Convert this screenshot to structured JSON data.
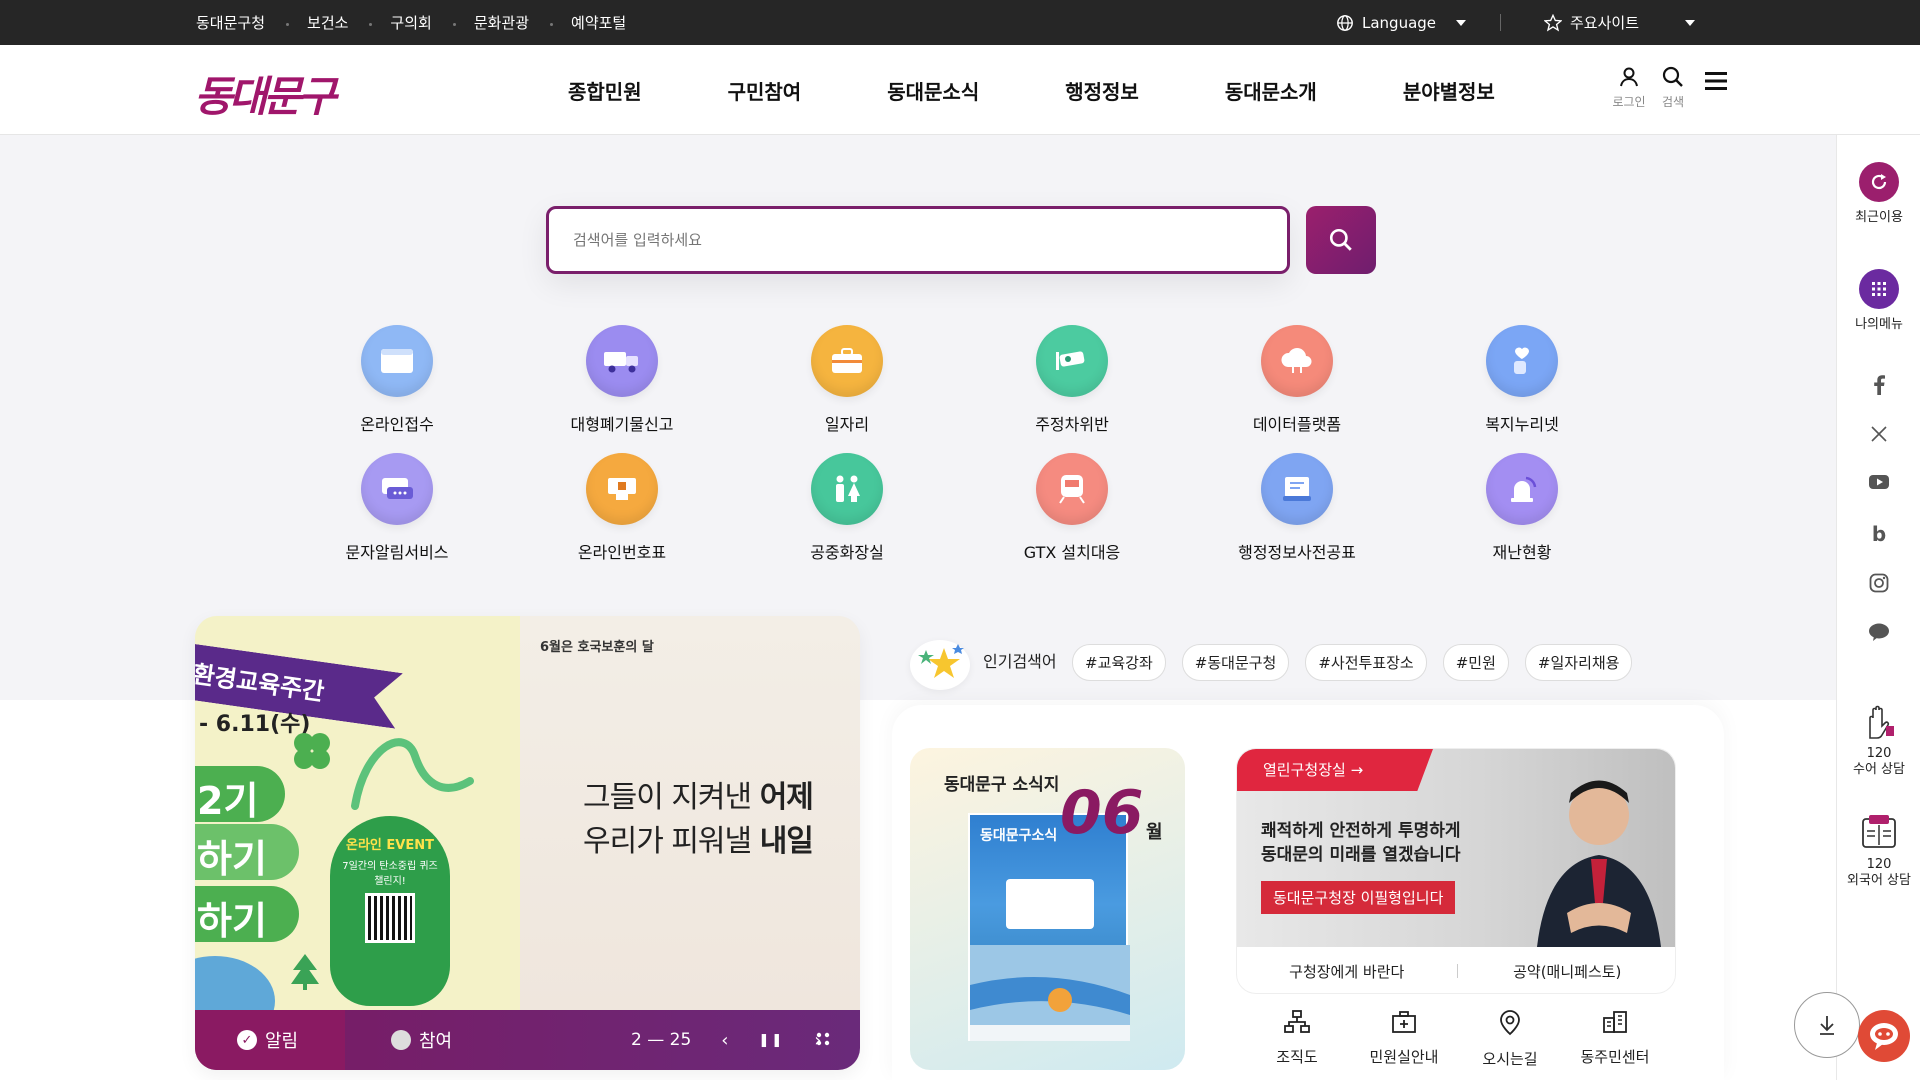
{
  "topbar": {
    "links": [
      "동대문구청",
      "보건소",
      "구의회",
      "문화관광",
      "예약포털"
    ],
    "language": "Language",
    "sites": "주요사이트"
  },
  "header": {
    "logo": "동대문구",
    "nav": [
      "종합민원",
      "구민참여",
      "동대문소식",
      "행정정보",
      "동대문소개",
      "분야별정보"
    ],
    "login": "로그인",
    "search": "검색"
  },
  "search": {
    "placeholder": "검색어를 입력하세요"
  },
  "quickmenu": [
    {
      "label": "온라인접수",
      "color": "#8fb8f5",
      "icon": "browser-icon"
    },
    {
      "label": "대형폐기물신고",
      "color": "#9b8cf0",
      "icon": "truck-icon"
    },
    {
      "label": "일자리",
      "color": "#f5b43f",
      "icon": "briefcase-icon"
    },
    {
      "label": "주정차위반",
      "color": "#4ccba0",
      "icon": "cctv-icon"
    },
    {
      "label": "데이터플랫폼",
      "color": "#f58a7a",
      "icon": "cloud-icon"
    },
    {
      "label": "복지누리넷",
      "color": "#7ba6f5",
      "icon": "heart-hand-icon"
    },
    {
      "label": "문자알림서비스",
      "color": "#a79af2",
      "icon": "message-icon"
    },
    {
      "label": "온라인번호표",
      "color": "#f5a93f",
      "icon": "kiosk-icon"
    },
    {
      "label": "공중화장실",
      "color": "#47c79b",
      "icon": "restroom-icon"
    },
    {
      "label": "GTX 설치대응",
      "color": "#f58b80",
      "icon": "train-icon"
    },
    {
      "label": "행정정보사전공표",
      "color": "#7fa5f2",
      "icon": "document-icon"
    },
    {
      "label": "재난현황",
      "color": "#a38ef2",
      "icon": "alarm-icon"
    }
  ],
  "banner": {
    "ribbon": "환경교육주간",
    "date": "- 6.11(수)",
    "green1": "2기",
    "green2": "하기",
    "green3": "하기",
    "event_tag": "온라인 EVENT",
    "event_text": "7일간의 탄소중립 퀴즈 챌린지!",
    "month_note": "6월은 호국보훈의 달",
    "copy1a": "그들이 지켜낸 ",
    "copy1b": "어제",
    "copy2a": "우리가 피워낼 ",
    "copy2b": "내일",
    "tab_alert": "알림",
    "tab_participate": "참여",
    "pager": "2 — 25"
  },
  "popular": {
    "title": "인기검색어",
    "tags": [
      "#교육강좌",
      "#동대문구청",
      "#사전투표장소",
      "#민원",
      "#일자리채용"
    ]
  },
  "newsletter": {
    "title": "동대문구 소식지",
    "number": "06",
    "month": "월",
    "cover_title": "동대문구소식"
  },
  "mayor": {
    "badge": "열린구청장실 →",
    "copy1": "쾌적하게 안전하게 투명하게",
    "copy2": "동대문의 미래를 열겠습니다",
    "name": "동대문구청장 이필형입니다",
    "link1": "구청장에게 바란다",
    "link2": "공약(매니페스토)"
  },
  "services": [
    {
      "label": "조직도",
      "icon": "org-chart-icon"
    },
    {
      "label": "민원실안내",
      "icon": "office-icon"
    },
    {
      "label": "오시는길",
      "icon": "location-icon"
    },
    {
      "label": "동주민센터",
      "icon": "building-icon"
    }
  ],
  "quickbar": {
    "recent": "최근이용",
    "mymenu": "나의메뉴",
    "sign1": "120",
    "sign2": "수어 상담",
    "foreign1": "120",
    "foreign2": "외국어 상담"
  },
  "colors": {
    "brand": "#8a1a62",
    "accent_red": "#e0263f"
  }
}
